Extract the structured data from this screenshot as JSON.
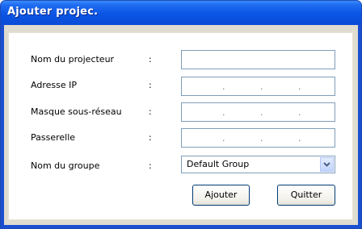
{
  "window": {
    "title": "Ajouter projec."
  },
  "form": {
    "projector_name_label": "Nom du projecteur",
    "ip_label": "Adresse IP",
    "mask_label": "Masque sous-réseau",
    "gateway_label": "Passerelle",
    "group_label": "Nom du groupe",
    "colon": ":",
    "ip_separator": ".",
    "group_value": "Default Group"
  },
  "buttons": {
    "add_label": "Ajouter",
    "quit_label": "Quitter"
  },
  "icons": {
    "dropdown": "chevron-down-icon"
  },
  "colors": {
    "titlebar": "#0b55e5",
    "client": "#dfdcd0",
    "field_border": "#7f9db9",
    "button_border": "#003c74"
  }
}
